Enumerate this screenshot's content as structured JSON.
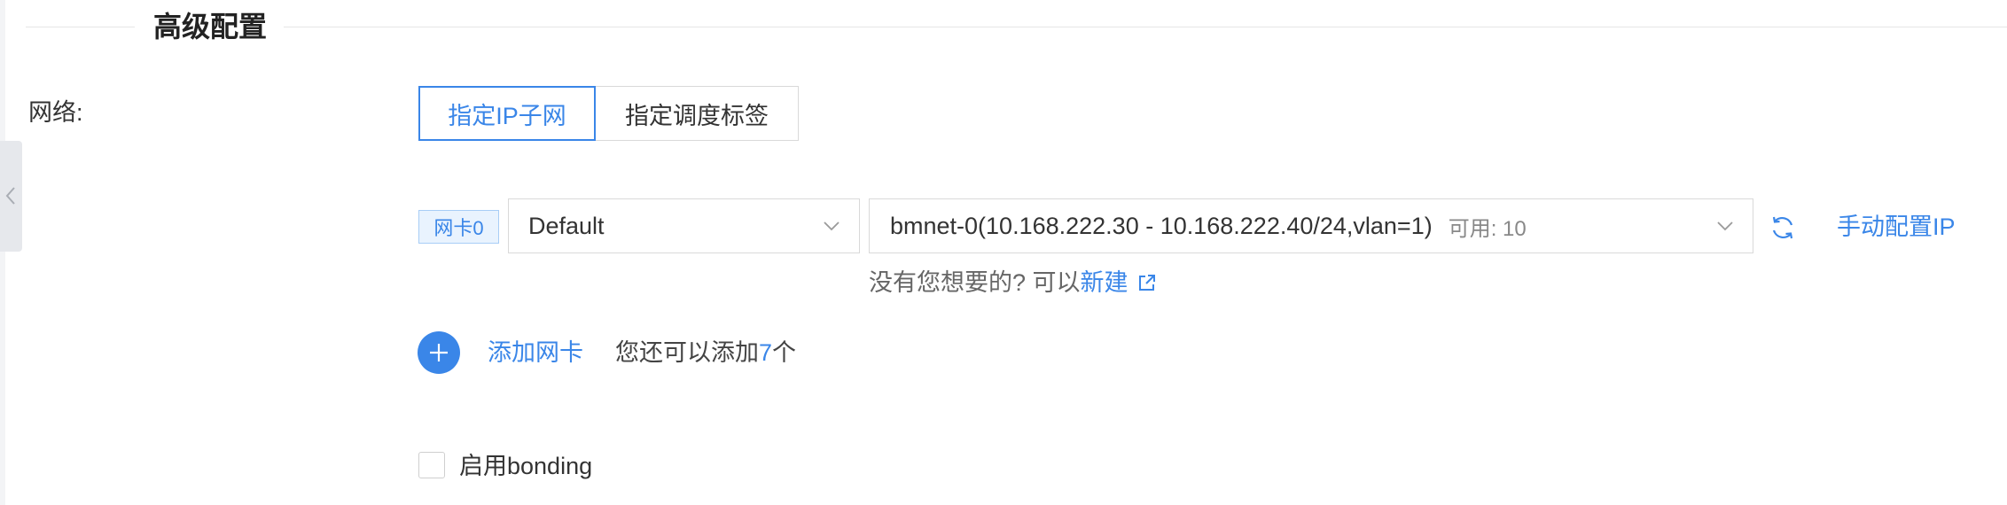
{
  "section": {
    "title": "高级配置"
  },
  "network": {
    "label": "网络:",
    "modes": [
      {
        "label": "指定IP子网",
        "selected": true
      },
      {
        "label": "指定调度标签",
        "selected": false
      }
    ],
    "nic": {
      "tag": "网卡0",
      "type_select": {
        "value": "Default"
      },
      "subnet_select": {
        "value": "bmnet-0(10.168.222.30 - 10.168.222.40/24,vlan=1)",
        "available_label": "可用: 10"
      },
      "manual_ip_label": "手动配置IP",
      "hint_text": "没有您想要的? 可以",
      "create_label": "新建"
    },
    "add_nic": {
      "label": "添加网卡",
      "remaining_prefix": "您还可以添加",
      "remaining_count": "7",
      "remaining_suffix": "个"
    },
    "bonding": {
      "label": "启用bonding",
      "checked": false
    }
  },
  "icons": {
    "side_tab": "chevron-left-icon",
    "select": "chevron-down-icon",
    "refresh": "refresh-icon",
    "create": "external-link-icon",
    "add": "plus-icon"
  },
  "colors": {
    "primary": "#3a86e8",
    "border": "#d9d9d9",
    "text": "#333333",
    "muted": "#666666",
    "tag_bg": "#e9f3fe",
    "tag_border": "#a8cdf6"
  }
}
